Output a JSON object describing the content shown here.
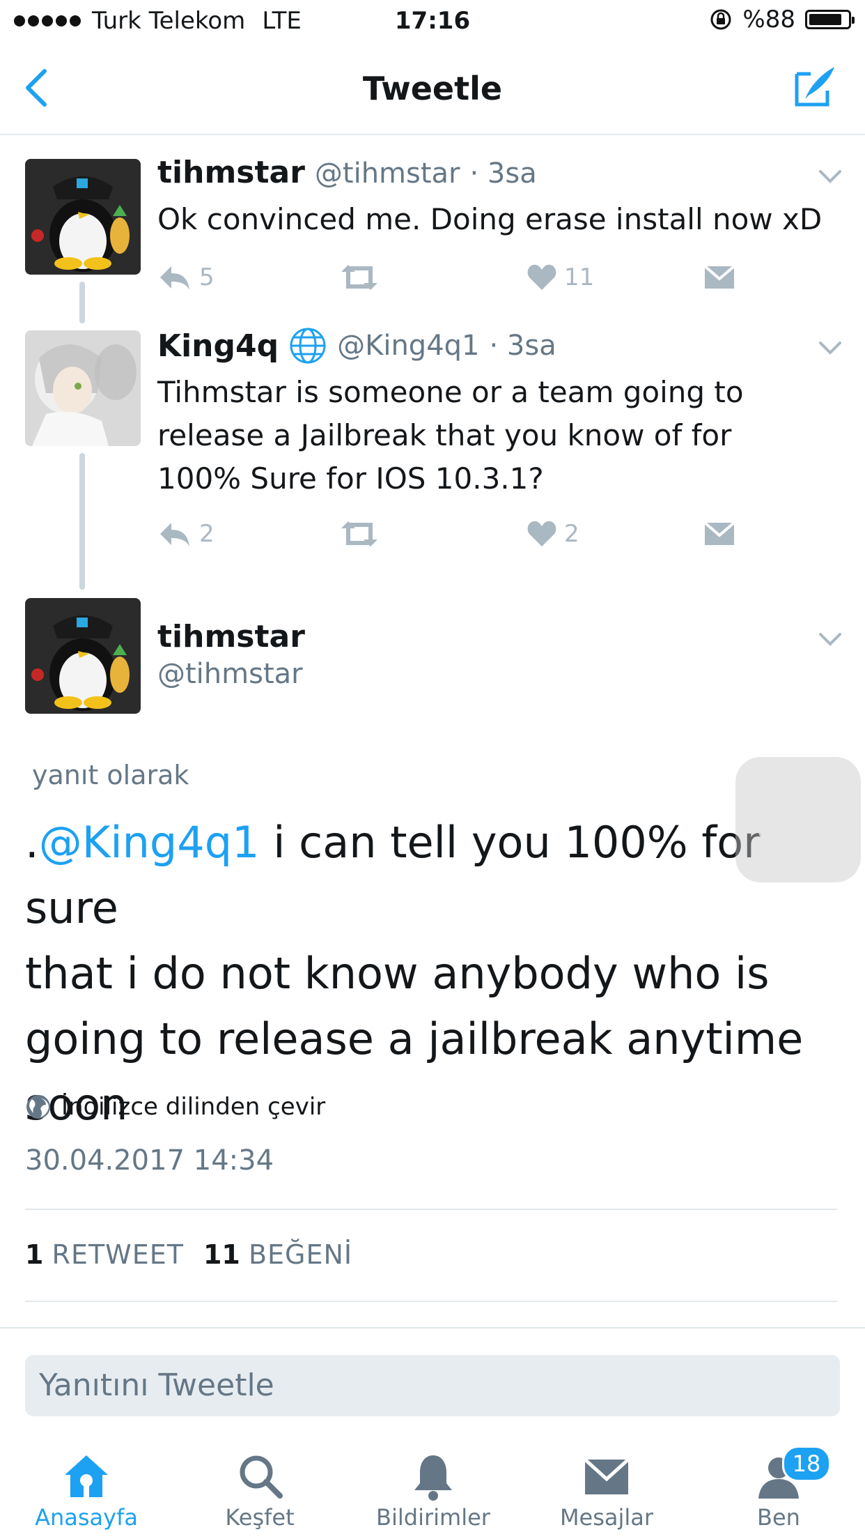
{
  "status_bar": {
    "carrier": "Turk Telekom",
    "network": "LTE",
    "time": "17:16",
    "battery_text": "%88",
    "battery_level": 0.88
  },
  "nav": {
    "title": "Tweetle",
    "back_icon": "chevron-left-icon",
    "compose_icon": "compose-tweet-icon"
  },
  "thread": [
    {
      "name": "tihmstar",
      "handle": "@tihmstar",
      "time": "· 3sa",
      "text": "Ok convinced me. Doing erase install now xD",
      "replies": "5",
      "retweets": "",
      "likes": "11"
    },
    {
      "name": "King4q",
      "handle": "@King4q1",
      "time": "· 3sa",
      "text_lines": [
        "Tihmstar is someone or a team going to",
        "release a Jailbreak that you know of for",
        "100% Sure for IOS 10.3.1?"
      ],
      "replies": "2",
      "retweets": "",
      "likes": "2"
    }
  ],
  "main_tweet": {
    "name": "tihmstar",
    "handle": "@tihmstar",
    "replying_to": "yanıt olarak",
    "text_prefix": ".",
    "mention": "@King4q1",
    "text_line1_rest": " i can tell you 100% for sure",
    "text_line2": "that i do not know anybody who is",
    "text_line3": "going to release a jailbreak anytime",
    "text_line4": "soon",
    "translate": "İngilizce dilinden çevir",
    "date": "30.04.2017 14:34",
    "retweet_count": "1",
    "retweet_label": "RETWEET",
    "like_count": "11",
    "like_label": "BEĞENİ"
  },
  "reply_box": {
    "placeholder": "Yanıtını Tweetle"
  },
  "tabbar": {
    "items": [
      {
        "label": "Anasayfa",
        "icon": "home-icon",
        "active": true
      },
      {
        "label": "Keşfet",
        "icon": "search-icon",
        "active": false
      },
      {
        "label": "Bildirimler",
        "icon": "bell-icon",
        "active": false
      },
      {
        "label": "Mesajlar",
        "icon": "envelope-icon",
        "active": false
      },
      {
        "label": "Ben",
        "icon": "profile-icon",
        "active": false,
        "badge": "18"
      }
    ]
  },
  "colors": {
    "accent": "#1da1f2",
    "secondary_text": "#657786",
    "icon_gray": "#aab8c2"
  }
}
